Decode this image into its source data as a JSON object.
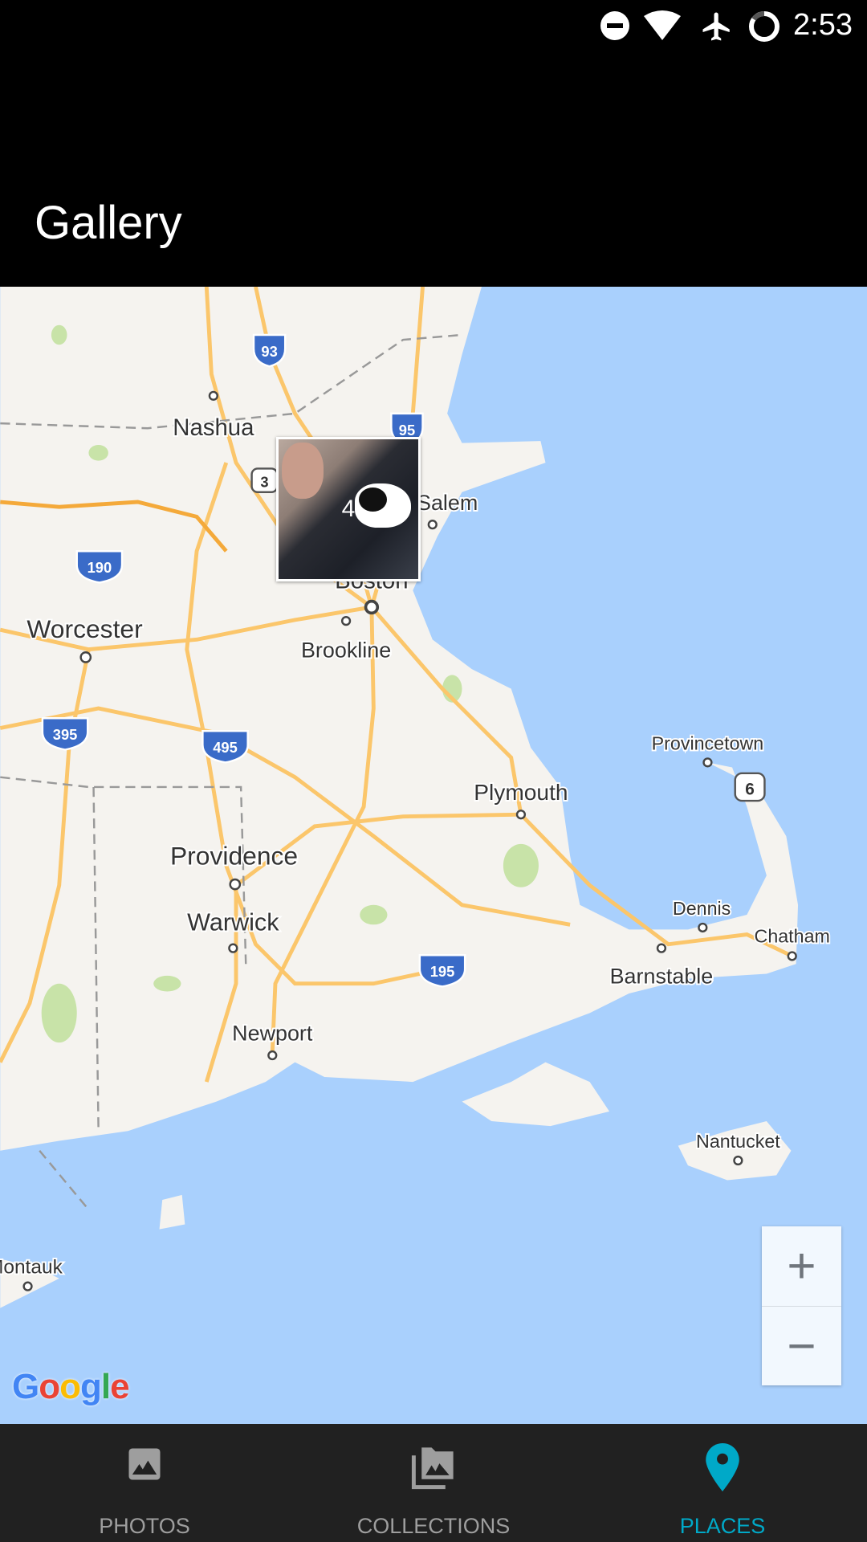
{
  "status_bar": {
    "time": "2:53",
    "icons": [
      "do-not-disturb-icon",
      "wifi-icon",
      "airplane-icon",
      "battery-charging-icon"
    ]
  },
  "app_bar": {
    "title": "Gallery"
  },
  "map": {
    "labels": {
      "nashua": "Nashua",
      "salem": "Salem",
      "boston": "Boston",
      "brookline": "Brookline",
      "worcester": "Worcester",
      "plymouth": "Plymouth",
      "provincetown": "Provincetown",
      "providence": "Providence",
      "warwick": "Warwick",
      "dennis": "Dennis",
      "chatham": "Chatham",
      "barnstable": "Barnstable",
      "newport": "Newport",
      "nantucket": "Nantucket",
      "montauk": "Montauk"
    },
    "shields": {
      "i93": "93",
      "i95": "95",
      "us3": "3",
      "i190": "190",
      "i395": "395",
      "i495": "495",
      "us6": "6",
      "i195": "195"
    },
    "photo_cluster": {
      "count": "4"
    },
    "zoom_in": "+",
    "zoom_out": "−",
    "colors": {
      "water": "#a9d0fd",
      "land": "#f5f3ef",
      "road": "#fbc66b",
      "park": "#c8e3a8"
    }
  },
  "bottom_nav": {
    "items": [
      {
        "label": "PHOTOS",
        "icon": "photo-icon",
        "active": false
      },
      {
        "label": "COLLECTIONS",
        "icon": "collections-icon",
        "active": false
      },
      {
        "label": "PLACES",
        "icon": "place-pin-icon",
        "active": true
      }
    ],
    "active_color": "#00a9c8"
  }
}
